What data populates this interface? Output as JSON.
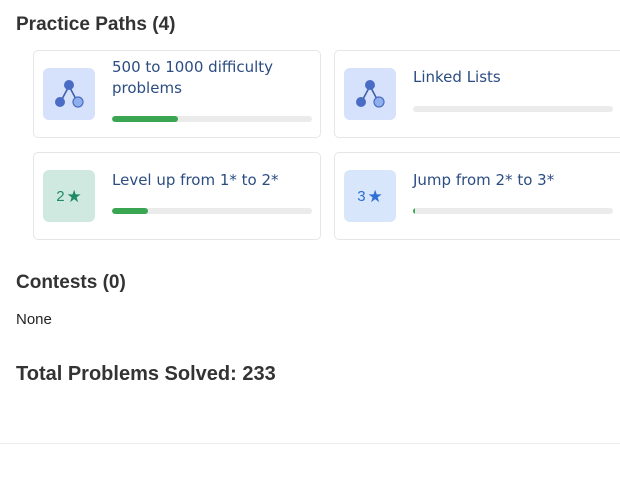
{
  "practice_paths": {
    "title": "Practice Paths (4)",
    "cards": [
      {
        "name": "500 to 1000 difficulty problems",
        "icon": "tree-icon",
        "progress": 0.33,
        "color": "#3aa652"
      },
      {
        "name": "Linked Lists",
        "icon": "tree-icon",
        "progress": 0.0,
        "color": "#3aa652"
      },
      {
        "name": "Level up from 1* to 2*",
        "icon_text": "2",
        "icon": "star-icon",
        "progress": 0.18,
        "color": "#3aa652"
      },
      {
        "name": "Jump from 2* to 3*",
        "icon_text": "3",
        "icon": "star-icon",
        "progress": 0.01,
        "color": "#3aa652"
      }
    ]
  },
  "contests": {
    "title": "Contests (0)",
    "empty_text": "None"
  },
  "total": {
    "title": "Total Problems Solved: 233"
  }
}
